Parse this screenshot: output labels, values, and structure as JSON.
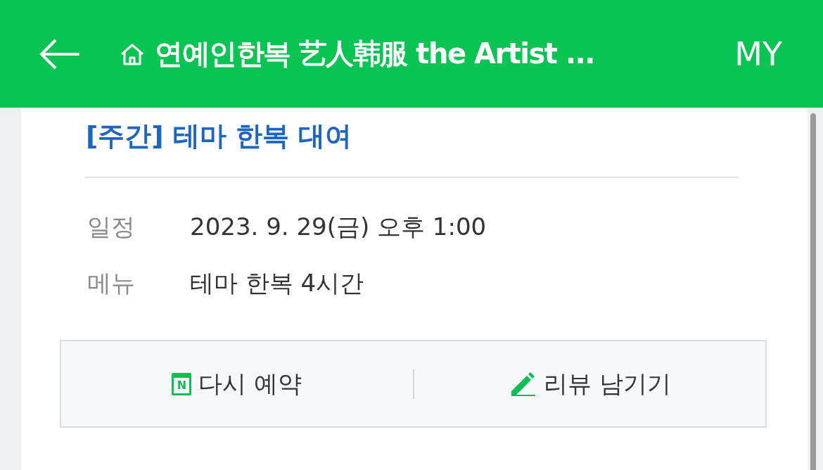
{
  "header": {
    "title": "연예인한복 艺人韩服 the Artist ...",
    "my": "MY"
  },
  "booking": {
    "title": "[주간] 테마 한복 대여",
    "details": [
      {
        "label": "일정",
        "value": "2023. 9. 29(금) 오후 1:00"
      },
      {
        "label": "메뉴",
        "value": "테마 한복 4시간"
      }
    ],
    "actions": [
      {
        "kind": "rebook",
        "label": "다시 예약",
        "icon_letter": "N"
      },
      {
        "kind": "review",
        "label": "리뷰 남기기"
      }
    ]
  }
}
